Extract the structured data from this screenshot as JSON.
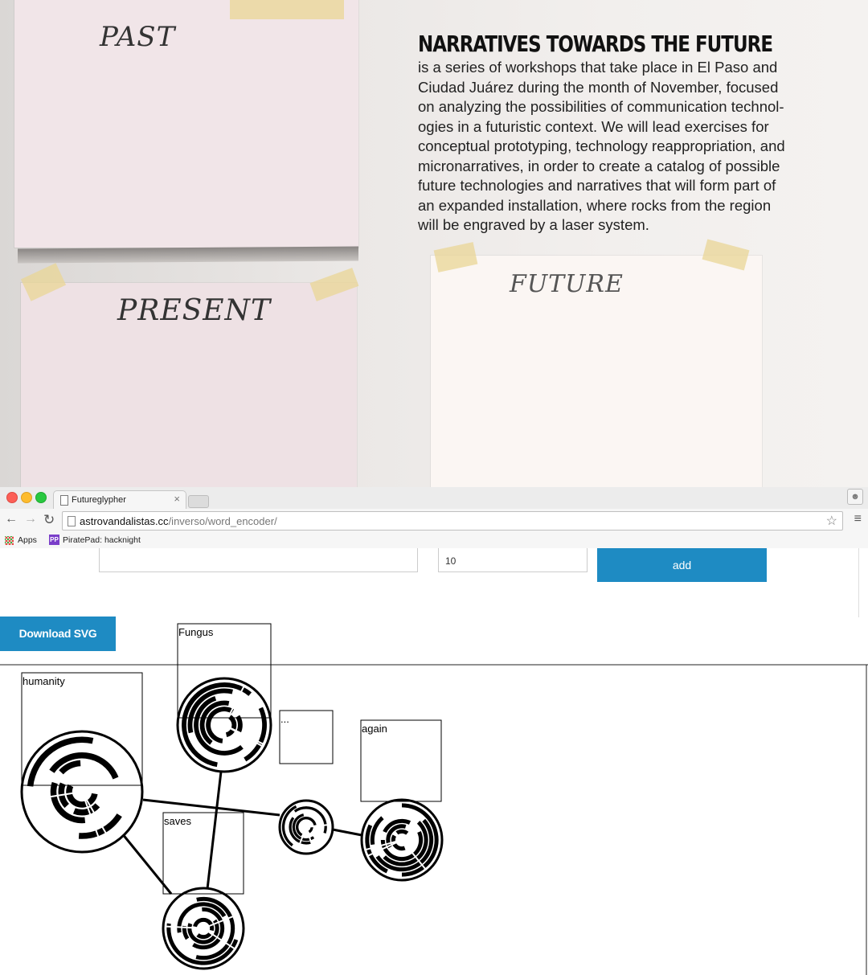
{
  "photo": {
    "labels": {
      "past": "PAST",
      "present": "PRESENT",
      "future": "FUTURE"
    },
    "headline": "NARRATIVES TOWARDS THE FUTURE",
    "body": "is a series of workshops that take place in El Paso and\nCiudad Juárez during the month of November, focused\non analyzing the possibilities of communication technol-\nogies in a futuristic context. We will lead exercises for\nconceptual prototyping, technology reappropriation, and\nmicronarratives, in order to create a catalog of possible\nfuture technologies and narratives that will form part of\nan expanded installation, where rocks from the region\nwill be engraved by a laser system."
  },
  "browser": {
    "tab_title": "Futureglypher",
    "tab_close": "×",
    "url_host": "astrovandalistas.cc",
    "url_path": "/inverso/word_encoder/",
    "bookmarks": {
      "apps": "Apps",
      "piratepad_badge": "PP",
      "piratepad": "PiratePad: hacknight"
    },
    "icons": [
      "back-arrow-icon",
      "forward-arrow-icon",
      "reload-icon",
      "page-icon",
      "star-icon",
      "menu-icon",
      "apps-grid-icon",
      "profile-icon"
    ]
  },
  "form": {
    "word_value": "",
    "size_value": "10",
    "add_label": "add",
    "download_label": "Download SVG"
  },
  "glyphs": [
    {
      "word": "humanity"
    },
    {
      "word": "Fungus"
    },
    {
      "word": "..."
    },
    {
      "word": "again"
    },
    {
      "word": "saves"
    },
    {
      "word": ""
    },
    {
      "word": ""
    }
  ],
  "connections": [
    [
      0,
      5
    ],
    [
      0,
      4
    ],
    [
      1,
      6
    ],
    [
      4,
      5
    ]
  ]
}
